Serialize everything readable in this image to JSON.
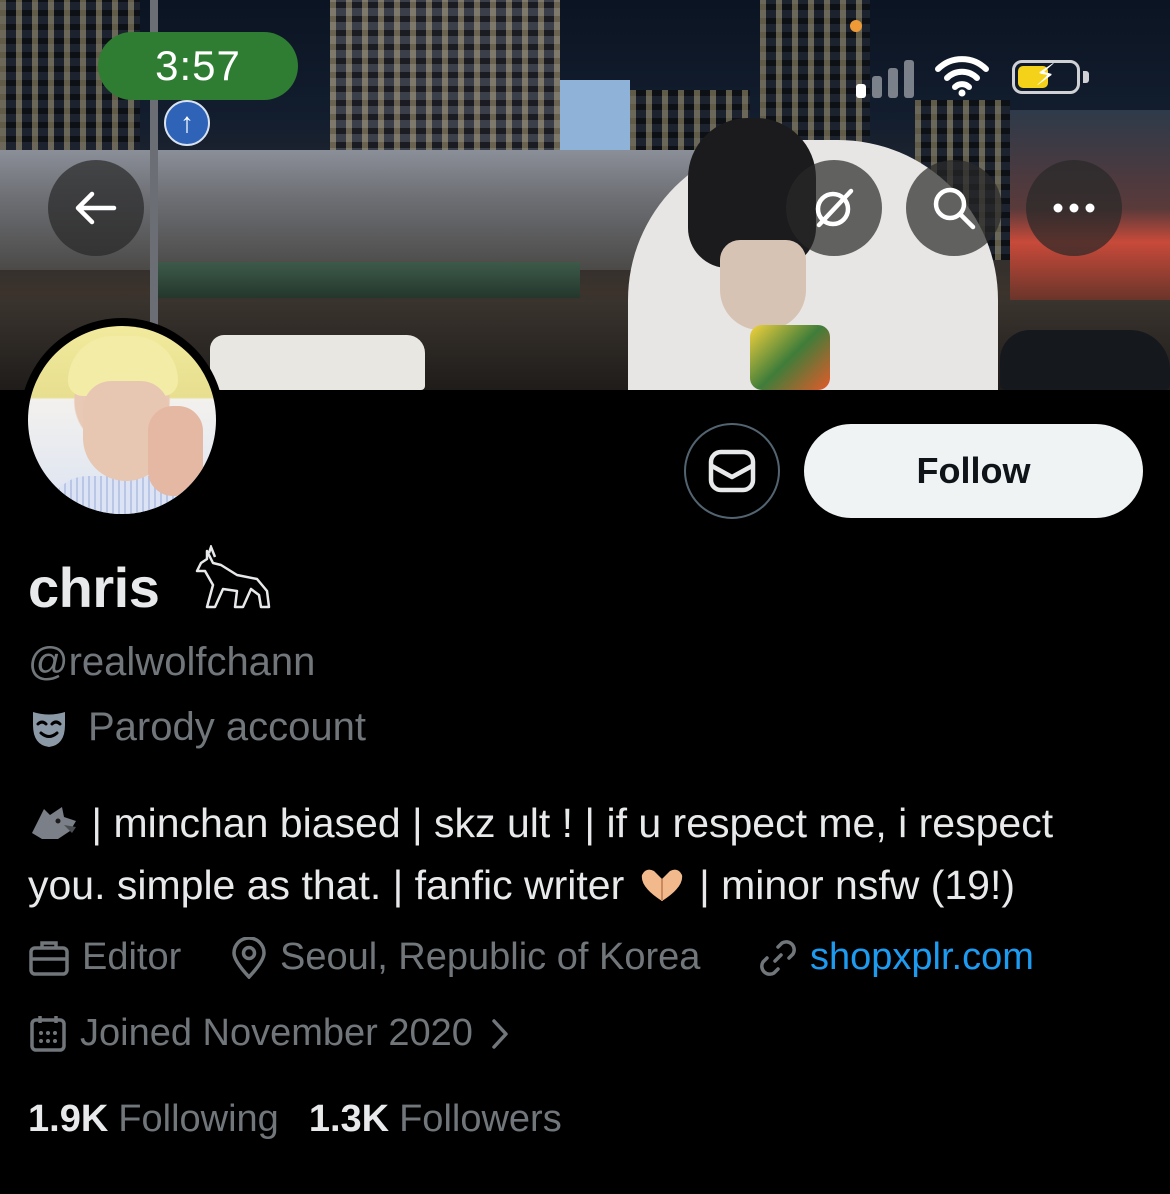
{
  "status_bar": {
    "time": "3:57"
  },
  "nav": {
    "back_icon": "arrow-left-icon",
    "grok_icon": "grok-icon",
    "search_icon": "search-icon",
    "more_icon": "more-horizontal-icon"
  },
  "profile": {
    "display_name": "chris",
    "handle": "@realwolfchann",
    "label": "Parody account",
    "bio_line1": "| minchan biased | skz ult ! | if u respect me, i respect",
    "bio_line2_a": "you. simple as that. | fanfic writer",
    "bio_line2_b": "| minor nsfw (19!)",
    "profession": "Editor",
    "location": "Seoul, Republic of Korea",
    "website": "shopxplr.com",
    "joined": "Joined November 2020",
    "following_count": "1.9K",
    "following_label": "Following",
    "followers_count": "1.3K",
    "followers_label": "Followers"
  },
  "actions": {
    "follow_label": "Follow",
    "message_icon": "mail-icon"
  },
  "colors": {
    "background": "#000000",
    "primary_text": "#e7e9ea",
    "secondary_text": "#71767b",
    "link": "#1d9bf0",
    "follow_bg": "#eff3f4",
    "time_pill": "#2f7d32",
    "battery": "#f5d21a"
  }
}
